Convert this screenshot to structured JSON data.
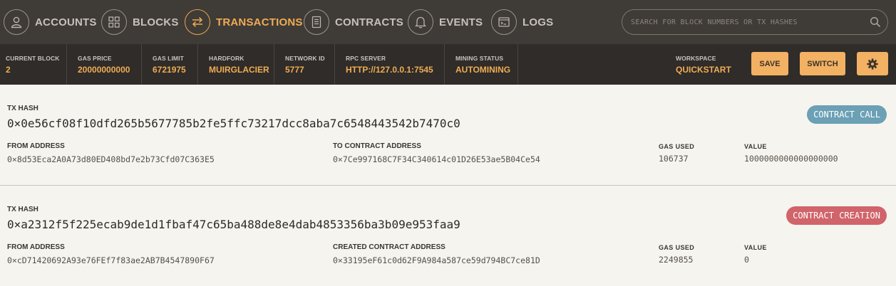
{
  "nav": {
    "items": [
      {
        "label": "ACCOUNTS"
      },
      {
        "label": "BLOCKS"
      },
      {
        "label": "TRANSACTIONS"
      },
      {
        "label": "CONTRACTS"
      },
      {
        "label": "EVENTS"
      },
      {
        "label": "LOGS"
      }
    ],
    "active": "TRANSACTIONS",
    "search_placeholder": "SEARCH FOR BLOCK NUMBERS OR TX HASHES"
  },
  "status": {
    "current_block": {
      "label": "CURRENT BLOCK",
      "value": "2"
    },
    "gas_price": {
      "label": "GAS PRICE",
      "value": "20000000000"
    },
    "gas_limit": {
      "label": "GAS LIMIT",
      "value": "6721975"
    },
    "hardfork": {
      "label": "HARDFORK",
      "value": "MUIRGLACIER"
    },
    "network_id": {
      "label": "NETWORK ID",
      "value": "5777"
    },
    "rpc_server": {
      "label": "RPC SERVER",
      "value": "HTTP://127.0.0.1:7545"
    },
    "mining_status": {
      "label": "MINING STATUS",
      "value": "AUTOMINING"
    },
    "workspace": {
      "label": "WORKSPACE",
      "value": "QUICKSTART"
    },
    "save_label": "SAVE",
    "switch_label": "SWITCH"
  },
  "transactions": [
    {
      "hash_label": "TX HASH",
      "hash": "0×0e56cf08f10dfd265b5677785b2fe5ffc73217dcc8aba7c6548443542b7470c0",
      "badge": "CONTRACT CALL",
      "from_label": "FROM ADDRESS",
      "from": "0×8d53Eca2A0A73d80ED408bd7e2b73Cfd07C363E5",
      "to_label": "TO CONTRACT ADDRESS",
      "to": "0×7Ce997168C7F34C340614c01D26E53ae5B04Ce54",
      "gas_label": "GAS USED",
      "gas": "106737",
      "value_label": "VALUE",
      "value": "1000000000000000000"
    },
    {
      "hash_label": "TX HASH",
      "hash": "0×a2312f5f225ecab9de1d1fbaf47c65ba488de8e4dab4853356ba3b09e953faa9",
      "badge": "CONTRACT CREATION",
      "from_label": "FROM ADDRESS",
      "from": "0×cD71420692A93e76FEf7f83ae2AB7B4547890F67",
      "to_label": "CREATED CONTRACT ADDRESS",
      "to": "0×33195eF61c0d62F9A984a587ce59d794BC7ce81D",
      "gas_label": "GAS USED",
      "gas": "2249855",
      "value_label": "VALUE",
      "value": "0"
    }
  ],
  "colors": {
    "nav_bg": "#3f3b37",
    "status_bg": "#2f2c29",
    "accent": "#f0ac54",
    "button": "#f3b163",
    "badge_call": "#6ba0b5",
    "badge_creation": "#d0646a"
  },
  "icons": {
    "accounts": "person-icon",
    "blocks": "grid-icon",
    "transactions": "swap-arrows-icon",
    "contracts": "document-icon",
    "events": "bell-icon",
    "logs": "terminal-icon",
    "search": "search-icon",
    "settings": "gear-icon"
  }
}
